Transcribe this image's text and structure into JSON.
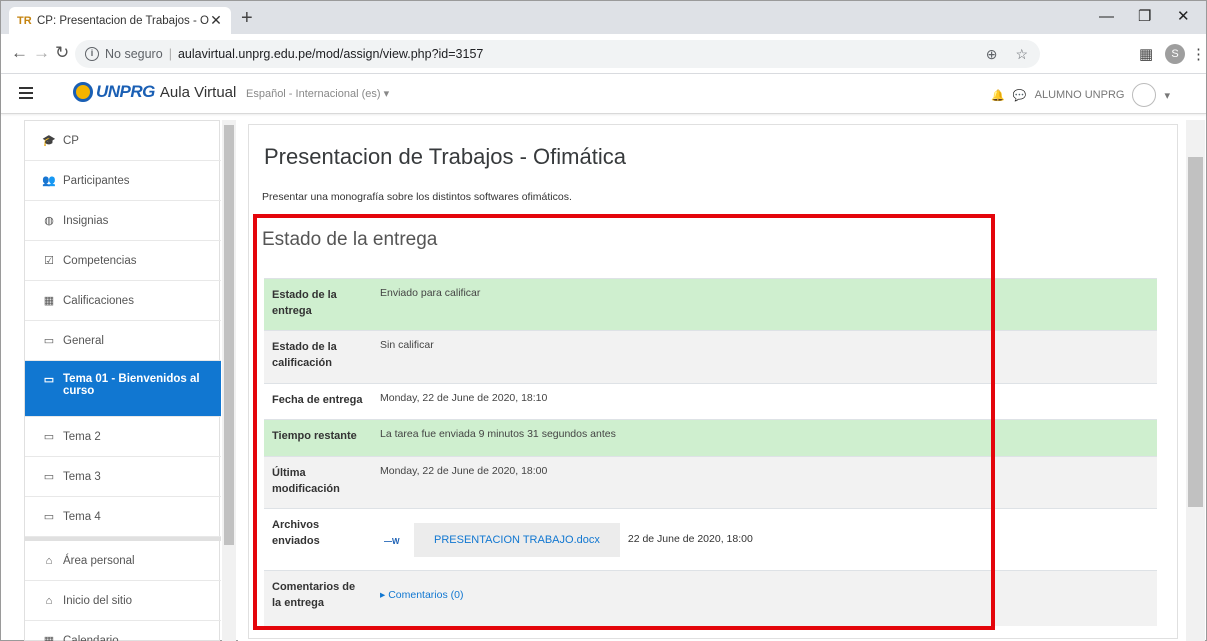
{
  "browser": {
    "tab_title": "CP: Presentacion de Trabajos - O",
    "tab_favicon": "TR",
    "tab_close": "✕",
    "new_tab": "+",
    "security": "No seguro",
    "url": "aulavirtual.unprg.edu.pe/mod/assign/view.php?id=3157",
    "profile_initial": "S"
  },
  "navbar": {
    "brand": "UNPRG",
    "site": "Aula Virtual",
    "language": "Español - Internacional (es) ▾",
    "user": "ALUMNO UNPRG"
  },
  "sidebar": {
    "items": [
      {
        "label": "CP",
        "icon": "🎓"
      },
      {
        "label": "Participantes",
        "icon": "👥"
      },
      {
        "label": "Insignias",
        "icon": "◍"
      },
      {
        "label": "Competencias",
        "icon": "☑"
      },
      {
        "label": "Calificaciones",
        "icon": "▦"
      },
      {
        "label": "General",
        "icon": "▭"
      },
      {
        "label": "Tema 01 - Bienvenidos al curso",
        "icon": "▭"
      },
      {
        "label": "Tema 2",
        "icon": "▭"
      },
      {
        "label": "Tema 3",
        "icon": "▭"
      },
      {
        "label": "Tema 4",
        "icon": "▭"
      },
      {
        "label": "Área personal",
        "icon": "⌂"
      },
      {
        "label": "Inicio del sitio",
        "icon": "⌂"
      },
      {
        "label": "Calendario",
        "icon": "▦"
      }
    ]
  },
  "page": {
    "title": "Presentacion de Trabajos - Ofimática",
    "intro": "Presentar una monografía sobre los distintos softwares ofimáticos.",
    "section": "Estado de la entrega"
  },
  "status": [
    {
      "key": "Estado de la entrega",
      "value": "Enviado para calificar"
    },
    {
      "key": "Estado de la calificación",
      "value": "Sin calificar"
    },
    {
      "key": "Fecha de entrega",
      "value": "Monday, 22 de June de 2020, 18:10"
    },
    {
      "key": "Tiempo restante",
      "value": "La tarea fue enviada 9 minutos 31 segundos antes"
    },
    {
      "key": "Última modificación",
      "value": "Monday, 22 de June de 2020, 18:00"
    },
    {
      "key": "Archivos enviados",
      "file": "PRESENTACION TRABAJO.docx",
      "date": "22 de June de 2020, 18:00"
    },
    {
      "key": "Comentarios de la entrega",
      "value": "▸ Comentarios (0)"
    }
  ],
  "colors": {
    "accent": "#1177d1",
    "submitted": "#cfefcf",
    "highlight": "#e4050b"
  }
}
